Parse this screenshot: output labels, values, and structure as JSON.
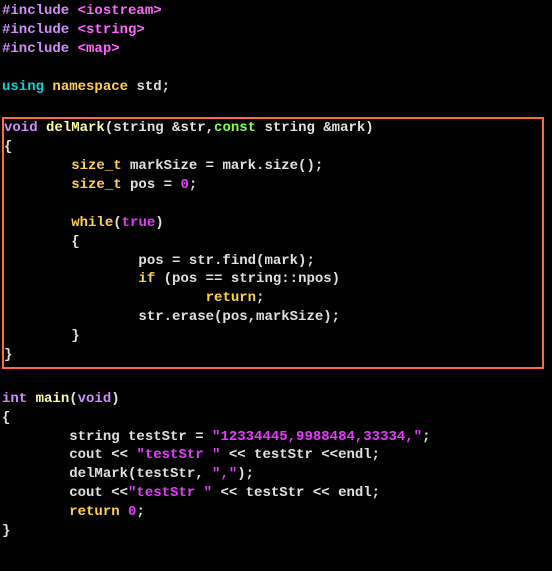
{
  "lines": {
    "l1_pre": "#include ",
    "l1_ang": "<iostream>",
    "l2_pre": "#include ",
    "l2_ang": "<string>",
    "l3_pre": "#include ",
    "l3_ang": "<map>",
    "l4": "",
    "l5_using": "using ",
    "l5_ns": "namespace ",
    "l5_std": "std;",
    "l6": "",
    "l7_void": "void ",
    "l7_fn": "delMark",
    "l7_p1": "(string &str,",
    "l7_const": "const ",
    "l7_p2": "string &mark)",
    "l8": "{",
    "l9_ind": "        ",
    "l9_sizet": "size_t ",
    "l9_rest": "markSize = mark.size();",
    "l10_ind": "        ",
    "l10_sizet": "size_t ",
    "l10_rest": "pos = ",
    "l10_zero": "0",
    "l10_semi": ";",
    "l11": "",
    "l12_ind": "        ",
    "l12_while": "while",
    "l12_p": "(",
    "l12_true": "true",
    "l12_p2": ")",
    "l13_ind": "        ",
    "l13_brace": "{",
    "l14_ind": "                ",
    "l14_rest": "pos = str.find(mark);",
    "l15_ind": "                ",
    "l15_if": "if ",
    "l15_rest": "(pos == string::npos)",
    "l16_ind": "                        ",
    "l16_ret": "return",
    "l16_semi": ";",
    "l17_ind": "                ",
    "l17_rest": "str.erase(pos,markSize);",
    "l18_ind": "        ",
    "l18_brace": "}",
    "l19": "}",
    "l20": "",
    "l21_int": "int ",
    "l21_fn": "main",
    "l21_p": "(",
    "l21_void": "void",
    "l21_p2": ")",
    "l22": "{",
    "l23_ind": "        ",
    "l23_a": "string testStr = ",
    "l23_str": "\"12334445,9988484,33334,\"",
    "l23_b": ";",
    "l24_ind": "        ",
    "l24_a": "cout << ",
    "l24_str": "\"testStr \"",
    "l24_b": " << testStr <<endl;",
    "l25_ind": "        ",
    "l25_a": "delMark(testStr, ",
    "l25_str": "\",\"",
    "l25_b": ");",
    "l26_ind": "        ",
    "l26_a": "cout <<",
    "l26_str": "\"testStr \"",
    "l26_b": " << testStr << endl;",
    "l27_ind": "        ",
    "l27_ret": "return ",
    "l27_zero": "0",
    "l27_semi": ";",
    "l28": "}"
  }
}
